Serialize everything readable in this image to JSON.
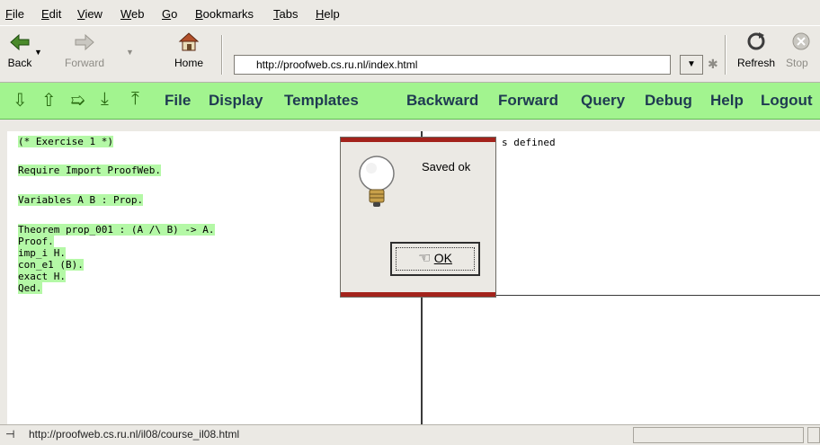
{
  "menu": {
    "items": [
      {
        "label": "File",
        "accel": "F",
        "rest": "ile"
      },
      {
        "label": "Edit",
        "accel": "E",
        "rest": "dit"
      },
      {
        "label": "View",
        "accel": "V",
        "rest": "iew"
      },
      {
        "label": "Web",
        "accel": "W",
        "rest": "eb"
      },
      {
        "label": "Go",
        "accel": "G",
        "rest": "o"
      },
      {
        "label": "Bookmarks",
        "accel": "B",
        "rest": "ookmarks"
      },
      {
        "label": "Tabs",
        "accel": "T",
        "rest": "abs"
      },
      {
        "label": "Help",
        "accel": "H",
        "rest": "elp"
      }
    ]
  },
  "nav": {
    "back_label": "Back",
    "forward_label": "Forward",
    "home_label": "Home",
    "url": "http://proofweb.cs.ru.nl/index.html",
    "refresh_label": "Refresh",
    "stop_label": "Stop"
  },
  "proofweb": {
    "menus": [
      "File",
      "Display",
      "Templates",
      "Backward",
      "Forward",
      "Query",
      "Debug",
      "Help",
      "Logout"
    ]
  },
  "editor": {
    "lines": [
      "(* Exercise 1 *)",
      "Require Import ProofWeb.",
      "Variables A B : Prop.",
      "Theorem prop_001 : (A /\\ B) -> A.",
      "Proof.",
      "imp_i H.",
      "con_e1 (B).",
      "exact H.",
      "Qed."
    ]
  },
  "goals": {
    "text": "s defined"
  },
  "dialog": {
    "message": "Saved ok",
    "ok_label": "OK"
  },
  "status": {
    "text": "http://proofweb.cs.ru.nl/il08/course_il08.html"
  },
  "colors": {
    "toolbar_green": "#a2f48f",
    "highlight": "#b4f8a6",
    "dialog_accent": "#a3231c"
  }
}
